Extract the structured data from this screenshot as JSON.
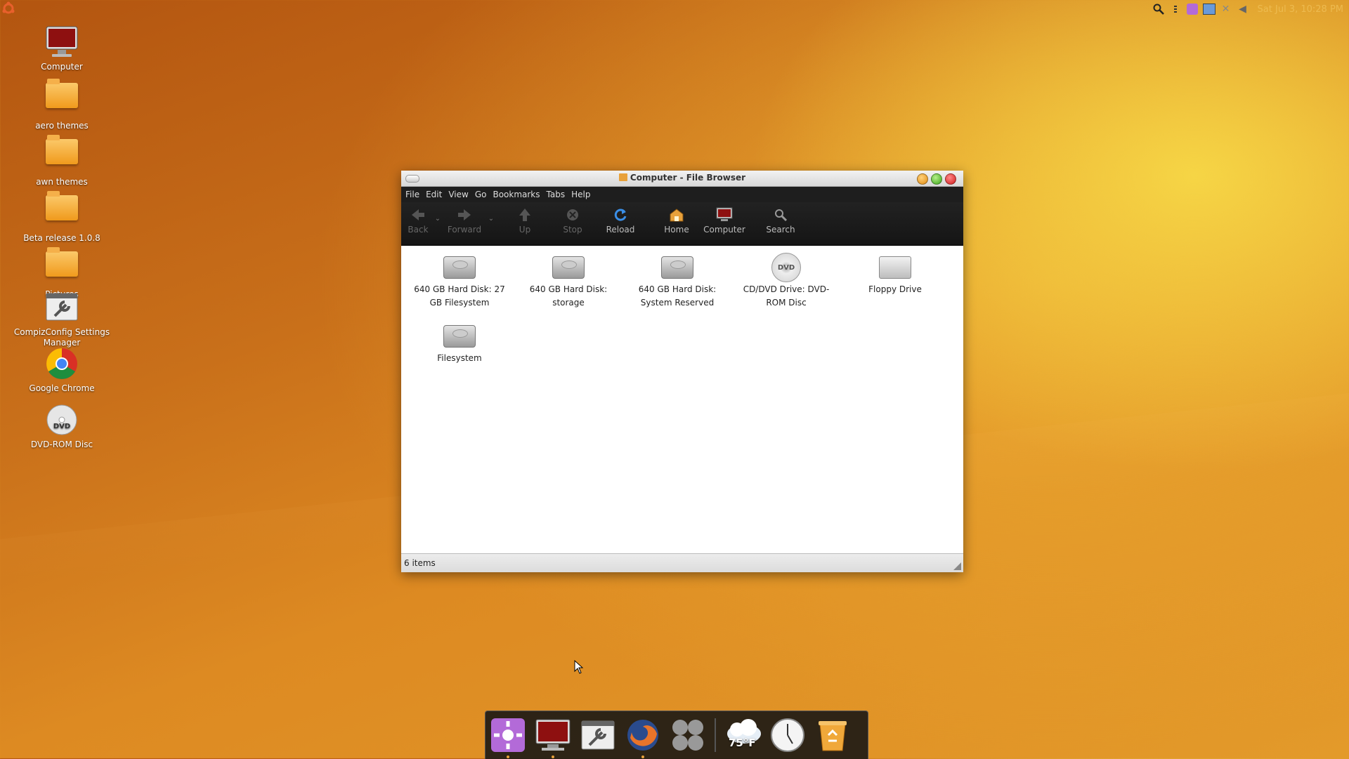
{
  "desktop": {
    "icons": [
      {
        "label": "Computer"
      },
      {
        "label": "aero themes"
      },
      {
        "label": "awn themes"
      },
      {
        "label": "Beta release 1.0.8"
      },
      {
        "label": "Pictures"
      },
      {
        "label": "CompizConfig Settings Manager"
      },
      {
        "label": "Google Chrome"
      },
      {
        "label": "DVD-ROM Disc"
      }
    ]
  },
  "panel": {
    "clock": "Sat Jul 3, 10:28 PM"
  },
  "window": {
    "title": "Computer - File Browser",
    "menu": [
      "File",
      "Edit",
      "View",
      "Go",
      "Bookmarks",
      "Tabs",
      "Help"
    ],
    "toolbar": {
      "back": "Back",
      "forward": "Forward",
      "up": "Up",
      "stop": "Stop",
      "reload": "Reload",
      "home": "Home",
      "computer": "Computer",
      "search": "Search"
    },
    "items": [
      {
        "label": "640 GB Hard Disk: 27 GB Filesystem",
        "type": "hard-disk"
      },
      {
        "label": "640 GB Hard Disk: storage",
        "type": "hard-disk"
      },
      {
        "label": "640 GB Hard Disk: System Reserved",
        "type": "hard-disk"
      },
      {
        "label": "CD/DVD Drive: DVD-ROM Disc",
        "type": "dvd"
      },
      {
        "label": "Floppy Drive",
        "type": "floppy"
      },
      {
        "label": "Filesystem",
        "type": "hard-disk"
      }
    ],
    "status": "6 items"
  },
  "dock": {
    "weather": "75°F"
  },
  "colors": {
    "accent": "#e8a13b",
    "menubar_bg": "#1e1e1e"
  }
}
